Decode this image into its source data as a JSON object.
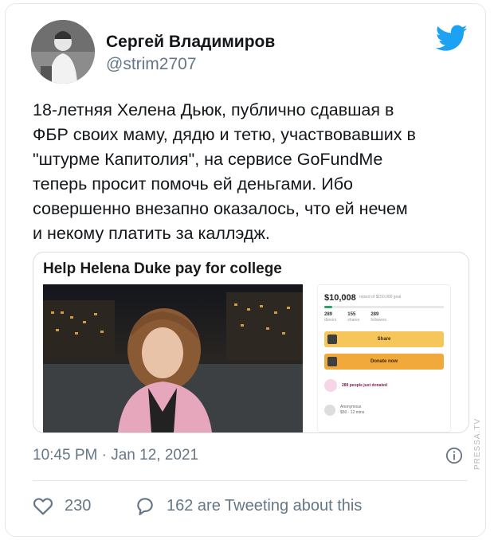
{
  "author": {
    "name": "Сергей Владимиров",
    "handle": "@strim2707"
  },
  "tweet": {
    "text": "18-летняя Хелена Дьюк, публично сдавшая  в\nФБР своих маму, дядю и тетю,  участвовавших  в\n\"штурме Капитолия\", на сервисе GoFundMe\nтеперь просит помочь ей деньгами.  Ибо\nсовершенно внезапно  оказалось, что ей нечем\nи некому платить за каллэдж."
  },
  "embed": {
    "title": "Help Helena Duke pay for college",
    "amount": "$10,008",
    "raised_text": "raised of $150,000 goal",
    "progress_fraction": 0.067,
    "stats": [
      {
        "value": "289",
        "label": "donors"
      },
      {
        "value": "155",
        "label": "shares"
      },
      {
        "value": "289",
        "label": "followers"
      }
    ],
    "share_label": "Share",
    "donate_label": "Donate now",
    "donated_text": "289 people just donated",
    "anon_name": "Anonymous",
    "anon_detail": "$50 · 12 mins"
  },
  "footer": {
    "timestamp": "10:45 PM · Jan 12, 2021",
    "likes": "230",
    "tweeting": "162 are Tweeting about this"
  },
  "watermark": "PRESSA.TV",
  "colors": {
    "twitter_blue": "#1da1f2",
    "muted": "#657786",
    "button_orange": "#f2a93b"
  },
  "icons": [
    "twitter-bird-icon",
    "info-icon",
    "heart-icon",
    "reply-bubble-icon"
  ]
}
